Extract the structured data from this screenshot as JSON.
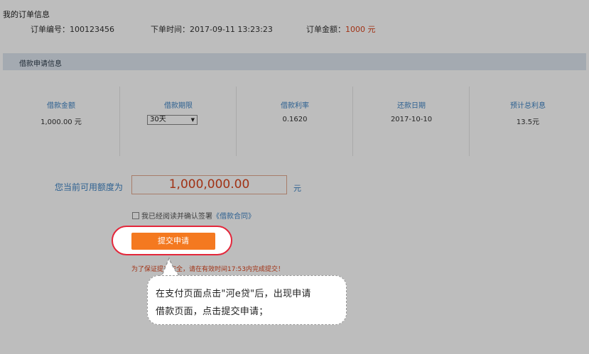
{
  "order": {
    "title": "我的订单信息",
    "number": "订单编号：100123456",
    "time": "下单时间：2017-09-11 13:23:23",
    "amount_label": "订单金额：",
    "amount_value": "1000 元"
  },
  "loan": {
    "section_title": "借款申请信息",
    "columns": [
      {
        "label": "借款金额",
        "value": "1,000.00 元"
      },
      {
        "label": "借款期限",
        "value": "30天"
      },
      {
        "label": "借款利率",
        "value": "0.1620"
      },
      {
        "label": "还款日期",
        "value": "2017-10-10"
      },
      {
        "label": "预计总利息",
        "value": "13.5元"
      }
    ]
  },
  "credit": {
    "label": "您当前可用额度为",
    "value": "1,000,000.00",
    "unit": "元"
  },
  "agreement": {
    "text": "我已经阅读并确认签署",
    "link": "《借款合同》",
    "checked": false
  },
  "submit": {
    "label": "提交申请"
  },
  "warning": "为了保证提交安全，请在有效时间17:53内完成提交！",
  "callout": {
    "line1": "在支付页面点击\"河e贷\"后，出现申请",
    "line2": "借款页面，点击提交申请；"
  },
  "colors": {
    "accent_orange": "#f47920",
    "amount_red": "#d9441d",
    "label_blue": "#3f84c4",
    "highlight_red": "#e4263a"
  }
}
